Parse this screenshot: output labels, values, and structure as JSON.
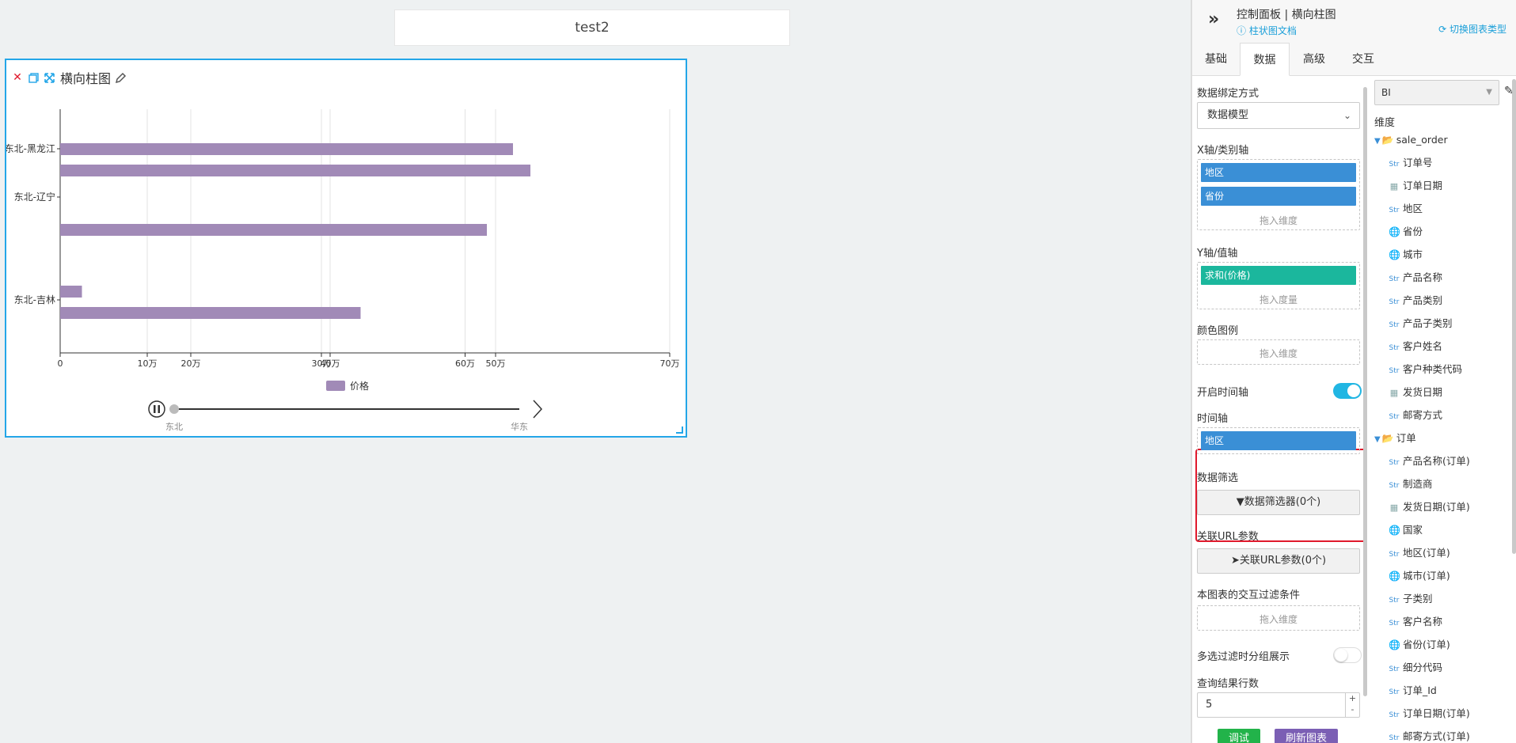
{
  "canvas": {
    "title": "test2"
  },
  "widget": {
    "title": "横向柱图",
    "icons": [
      "close-icon",
      "copy-icon",
      "expand-icon",
      "edit-icon"
    ]
  },
  "chart_data": {
    "type": "bar",
    "orientation": "horizontal",
    "categories": [
      "东北-黑龙江",
      "东北-辽宁",
      "东北-吉林"
    ],
    "bars": [
      {
        "category": "东北-黑龙江",
        "value": 520000
      },
      {
        "category": "东北-黑龙江",
        "value": 540000
      },
      {
        "category": "东北-辽宁",
        "value": 490000
      },
      {
        "category": "东北-吉林",
        "value": 25000
      },
      {
        "category": "东北-吉林",
        "value": 345000
      }
    ],
    "xticks": [
      {
        "label": "0",
        "value": 0
      },
      {
        "label": "10万",
        "value": 100000
      },
      {
        "label": "20万",
        "value": 150000
      },
      {
        "label": "30万",
        "value": 300000
      },
      {
        "label": "40万",
        "value": 310000
      },
      {
        "label": "60万",
        "value": 465000
      },
      {
        "label": "50万",
        "value": 500000
      },
      {
        "label": "70万",
        "value": 700000
      }
    ],
    "xlim": [
      0,
      700000
    ],
    "legend": "价格",
    "legend_position": "bottom",
    "series_color": "#a18ab7",
    "timeline": {
      "start": "东北",
      "end": "华东"
    }
  },
  "panel": {
    "title": "控制面板 | 横向柱图",
    "doc_link": "柱状图文档",
    "switch_type": "切换图表类型",
    "tabs": [
      "基础",
      "数据",
      "高级",
      "交互"
    ],
    "active_tab": "数据",
    "binding_label": "数据绑定方式",
    "binding_value": "数据模型",
    "x_axis_label": "X轴/类别轴",
    "x_chips": [
      "地区",
      "省份"
    ],
    "drop_dimension": "拖入维度",
    "y_axis_label": "Y轴/值轴",
    "y_chips": [
      "求和(价格)"
    ],
    "drop_measure": "拖入度量",
    "color_legend_label": "颜色图例",
    "timeline_toggle_label": "开启时间轴",
    "timeline_label": "时间轴",
    "timeline_chips": [
      "地区"
    ],
    "filter_label": "数据筛选",
    "filter_button": "数据筛选器(0个)",
    "url_param_label": "关联URL参数",
    "url_param_button": "关联URL参数(0个)",
    "interact_filter_label": "本图表的交互过滤条件",
    "multi_filter_label": "多选过滤时分组展示",
    "rows_label": "查询结果行数",
    "rows_value": "5",
    "debug_button": "调试",
    "refresh_button": "刷新图表",
    "colors": {
      "accent": "#21b6e3",
      "chip_blue": "#3a8fd6",
      "chip_green": "#1bb79d",
      "debug": "#22b34a",
      "refresh": "#7b5fb4"
    }
  },
  "fields": {
    "source": "BI",
    "dimension_label": "维度",
    "groups": [
      {
        "name": "sale_order",
        "items": [
          {
            "type": "str",
            "name": "订单号"
          },
          {
            "type": "date",
            "name": "订单日期"
          },
          {
            "type": "str",
            "name": "地区"
          },
          {
            "type": "geo",
            "name": "省份"
          },
          {
            "type": "geo",
            "name": "城市"
          },
          {
            "type": "str",
            "name": "产品名称"
          },
          {
            "type": "str",
            "name": "产品类别"
          },
          {
            "type": "str",
            "name": "产品子类别"
          },
          {
            "type": "str",
            "name": "客户姓名"
          },
          {
            "type": "str",
            "name": "客户种类代码"
          },
          {
            "type": "date",
            "name": "发货日期"
          },
          {
            "type": "str",
            "name": "邮寄方式"
          }
        ]
      },
      {
        "name": "订单",
        "items": [
          {
            "type": "str",
            "name": "产品名称(订单)"
          },
          {
            "type": "str",
            "name": "制造商"
          },
          {
            "type": "date",
            "name": "发货日期(订单)"
          },
          {
            "type": "geo",
            "name": "国家"
          },
          {
            "type": "str",
            "name": "地区(订单)"
          },
          {
            "type": "geo",
            "name": "城市(订单)"
          },
          {
            "type": "str",
            "name": "子类别"
          },
          {
            "type": "str",
            "name": "客户名称"
          },
          {
            "type": "geo",
            "name": "省份(订单)"
          },
          {
            "type": "str",
            "name": "细分代码"
          },
          {
            "type": "str",
            "name": "订单_Id"
          },
          {
            "type": "str",
            "name": "订单日期(订单)"
          },
          {
            "type": "str",
            "name": "邮寄方式(订单)"
          }
        ]
      }
    ],
    "type_badges": {
      "str": "Str"
    }
  }
}
